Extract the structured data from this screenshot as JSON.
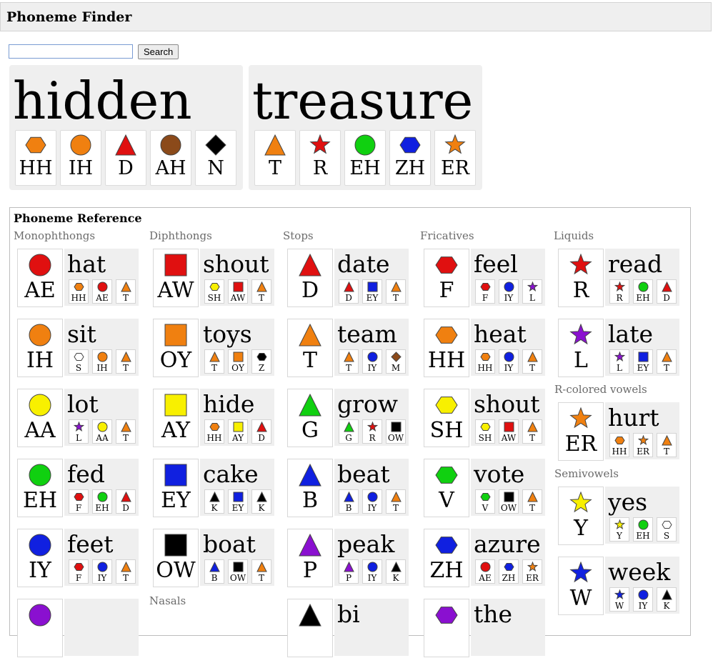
{
  "app": {
    "title": "Phoneme Finder"
  },
  "search": {
    "value": "",
    "placeholder": "",
    "button_label": "Search"
  },
  "words": [
    {
      "text": "hidden",
      "phonemes": [
        {
          "label": "HH",
          "shape": "hexagon",
          "color": "#f08010"
        },
        {
          "label": "IH",
          "shape": "circle",
          "color": "#f08010"
        },
        {
          "label": "D",
          "shape": "triangle",
          "color": "#e01010"
        },
        {
          "label": "AH",
          "shape": "circle",
          "color": "#8b4a1a"
        },
        {
          "label": "N",
          "shape": "diamond",
          "color": "#000000"
        }
      ]
    },
    {
      "text": "treasure",
      "phonemes": [
        {
          "label": "T",
          "shape": "triangle",
          "color": "#f08010"
        },
        {
          "label": "R",
          "shape": "star",
          "color": "#e01010"
        },
        {
          "label": "EH",
          "shape": "circle",
          "color": "#10d010"
        },
        {
          "label": "ZH",
          "shape": "hexagon",
          "color": "#1020e0"
        },
        {
          "label": "ER",
          "shape": "star",
          "color": "#f08010"
        }
      ]
    }
  ],
  "reference": {
    "title": "Phoneme Reference",
    "categories": [
      {
        "name": "Monophthongs",
        "items": [
          {
            "symbol": "AE",
            "shape": "circle",
            "color": "#e01010",
            "word": "hat",
            "parts": [
              [
                "HH",
                "hexagon",
                "#f08010"
              ],
              [
                "AE",
                "circle",
                "#e01010"
              ],
              [
                "T",
                "triangle",
                "#f08010"
              ]
            ]
          },
          {
            "symbol": "IH",
            "shape": "circle",
            "color": "#f08010",
            "word": "sit",
            "parts": [
              [
                "S",
                "hexagon",
                "#ffffff"
              ],
              [
                "IH",
                "circle",
                "#f08010"
              ],
              [
                "T",
                "triangle",
                "#f08010"
              ]
            ]
          },
          {
            "symbol": "AA",
            "shape": "circle",
            "color": "#f8f000",
            "word": "lot",
            "parts": [
              [
                "L",
                "star",
                "#8a10d0"
              ],
              [
                "AA",
                "circle",
                "#f8f000"
              ],
              [
                "T",
                "triangle",
                "#f08010"
              ]
            ]
          },
          {
            "symbol": "EH",
            "shape": "circle",
            "color": "#10d010",
            "word": "fed",
            "parts": [
              [
                "F",
                "hexagon",
                "#e01010"
              ],
              [
                "EH",
                "circle",
                "#10d010"
              ],
              [
                "D",
                "triangle",
                "#e01010"
              ]
            ]
          },
          {
            "symbol": "IY",
            "shape": "circle",
            "color": "#1020e0",
            "word": "feet",
            "parts": [
              [
                "F",
                "hexagon",
                "#e01010"
              ],
              [
                "IY",
                "circle",
                "#1020e0"
              ],
              [
                "T",
                "triangle",
                "#f08010"
              ]
            ]
          },
          {
            "symbol": "",
            "shape": "circle",
            "color": "#8a10d0",
            "word": "",
            "parts": []
          }
        ]
      },
      {
        "name": "Diphthongs",
        "items": [
          {
            "symbol": "AW",
            "shape": "square",
            "color": "#e01010",
            "word": "shout",
            "parts": [
              [
                "SH",
                "hexagon",
                "#f8f000"
              ],
              [
                "AW",
                "square",
                "#e01010"
              ],
              [
                "T",
                "triangle",
                "#f08010"
              ]
            ]
          },
          {
            "symbol": "OY",
            "shape": "square",
            "color": "#f08010",
            "word": "toys",
            "parts": [
              [
                "T",
                "triangle",
                "#f08010"
              ],
              [
                "OY",
                "square",
                "#f08010"
              ],
              [
                "Z",
                "hexagon",
                "#000000"
              ]
            ]
          },
          {
            "symbol": "AY",
            "shape": "square",
            "color": "#f8f000",
            "word": "hide",
            "parts": [
              [
                "HH",
                "hexagon",
                "#f08010"
              ],
              [
                "AY",
                "square",
                "#f8f000"
              ],
              [
                "D",
                "triangle",
                "#e01010"
              ]
            ]
          },
          {
            "symbol": "EY",
            "shape": "square",
            "color": "#1020e0",
            "word": "cake",
            "parts": [
              [
                "K",
                "triangle",
                "#000000"
              ],
              [
                "EY",
                "square",
                "#1020e0"
              ],
              [
                "K",
                "triangle",
                "#000000"
              ]
            ]
          },
          {
            "symbol": "OW",
            "shape": "square",
            "color": "#000000",
            "word": "boat",
            "parts": [
              [
                "B",
                "triangle",
                "#1020e0"
              ],
              [
                "OW",
                "square",
                "#000000"
              ],
              [
                "T",
                "triangle",
                "#f08010"
              ]
            ]
          }
        ]
      },
      {
        "name": "Nasals",
        "items": []
      },
      {
        "name": "Stops",
        "items": [
          {
            "symbol": "D",
            "shape": "triangle",
            "color": "#e01010",
            "word": "date",
            "parts": [
              [
                "D",
                "triangle",
                "#e01010"
              ],
              [
                "EY",
                "square",
                "#1020e0"
              ],
              [
                "T",
                "triangle",
                "#f08010"
              ]
            ]
          },
          {
            "symbol": "T",
            "shape": "triangle",
            "color": "#f08010",
            "word": "team",
            "parts": [
              [
                "T",
                "triangle",
                "#f08010"
              ],
              [
                "IY",
                "circle",
                "#1020e0"
              ],
              [
                "M",
                "diamond",
                "#8b4a1a"
              ]
            ]
          },
          {
            "symbol": "G",
            "shape": "triangle",
            "color": "#10d010",
            "word": "grow",
            "parts": [
              [
                "G",
                "triangle",
                "#10d010"
              ],
              [
                "R",
                "star",
                "#e01010"
              ],
              [
                "OW",
                "square",
                "#000000"
              ]
            ]
          },
          {
            "symbol": "B",
            "shape": "triangle",
            "color": "#1020e0",
            "word": "beat",
            "parts": [
              [
                "B",
                "triangle",
                "#1020e0"
              ],
              [
                "IY",
                "circle",
                "#1020e0"
              ],
              [
                "T",
                "triangle",
                "#f08010"
              ]
            ]
          },
          {
            "symbol": "P",
            "shape": "triangle",
            "color": "#8a10d0",
            "word": "peak",
            "parts": [
              [
                "P",
                "triangle",
                "#8a10d0"
              ],
              [
                "IY",
                "circle",
                "#1020e0"
              ],
              [
                "K",
                "triangle",
                "#000000"
              ]
            ]
          },
          {
            "symbol": "",
            "shape": "triangle",
            "color": "#000000",
            "word": "bi",
            "parts": []
          }
        ]
      },
      {
        "name": "Fricatives",
        "items": [
          {
            "symbol": "F",
            "shape": "hexagon",
            "color": "#e01010",
            "word": "feel",
            "parts": [
              [
                "F",
                "hexagon",
                "#e01010"
              ],
              [
                "IY",
                "circle",
                "#1020e0"
              ],
              [
                "L",
                "star",
                "#8a10d0"
              ]
            ]
          },
          {
            "symbol": "HH",
            "shape": "hexagon",
            "color": "#f08010",
            "word": "heat",
            "parts": [
              [
                "HH",
                "hexagon",
                "#f08010"
              ],
              [
                "IY",
                "circle",
                "#1020e0"
              ],
              [
                "T",
                "triangle",
                "#f08010"
              ]
            ]
          },
          {
            "symbol": "SH",
            "shape": "hexagon",
            "color": "#f8f000",
            "word": "shout",
            "parts": [
              [
                "SH",
                "hexagon",
                "#f8f000"
              ],
              [
                "AW",
                "square",
                "#e01010"
              ],
              [
                "T",
                "triangle",
                "#f08010"
              ]
            ]
          },
          {
            "symbol": "V",
            "shape": "hexagon",
            "color": "#10d010",
            "word": "vote",
            "parts": [
              [
                "V",
                "hexagon",
                "#10d010"
              ],
              [
                "OW",
                "square",
                "#000000"
              ],
              [
                "T",
                "triangle",
                "#f08010"
              ]
            ]
          },
          {
            "symbol": "ZH",
            "shape": "hexagon",
            "color": "#1020e0",
            "word": "azure",
            "parts": [
              [
                "AE",
                "circle",
                "#e01010"
              ],
              [
                "ZH",
                "hexagon",
                "#1020e0"
              ],
              [
                "ER",
                "star",
                "#f08010"
              ]
            ]
          },
          {
            "symbol": "",
            "shape": "hexagon",
            "color": "#8a10d0",
            "word": "the",
            "parts": []
          }
        ]
      },
      {
        "name": "Liquids",
        "items": [
          {
            "symbol": "R",
            "shape": "star",
            "color": "#e01010",
            "word": "read",
            "parts": [
              [
                "R",
                "star",
                "#e01010"
              ],
              [
                "EH",
                "circle",
                "#10d010"
              ],
              [
                "D",
                "triangle",
                "#e01010"
              ]
            ]
          },
          {
            "symbol": "L",
            "shape": "star",
            "color": "#8a10d0",
            "word": "late",
            "parts": [
              [
                "L",
                "star",
                "#8a10d0"
              ],
              [
                "EY",
                "square",
                "#1020e0"
              ],
              [
                "T",
                "triangle",
                "#f08010"
              ]
            ]
          }
        ]
      },
      {
        "name": "R-colored vowels",
        "items": [
          {
            "symbol": "ER",
            "shape": "star",
            "color": "#f08010",
            "word": "hurt",
            "parts": [
              [
                "HH",
                "hexagon",
                "#f08010"
              ],
              [
                "ER",
                "star",
                "#f08010"
              ],
              [
                "T",
                "triangle",
                "#f08010"
              ]
            ]
          }
        ]
      },
      {
        "name": "Semivowels",
        "items": [
          {
            "symbol": "Y",
            "shape": "star",
            "color": "#f8f000",
            "word": "yes",
            "parts": [
              [
                "Y",
                "star",
                "#f8f000"
              ],
              [
                "EH",
                "circle",
                "#10d010"
              ],
              [
                "S",
                "hexagon",
                "#ffffff"
              ]
            ]
          },
          {
            "symbol": "W",
            "shape": "star",
            "color": "#1020e0",
            "word": "week",
            "parts": [
              [
                "W",
                "star",
                "#1020e0"
              ],
              [
                "IY",
                "circle",
                "#1020e0"
              ],
              [
                "K",
                "triangle",
                "#000000"
              ]
            ]
          }
        ]
      }
    ]
  }
}
